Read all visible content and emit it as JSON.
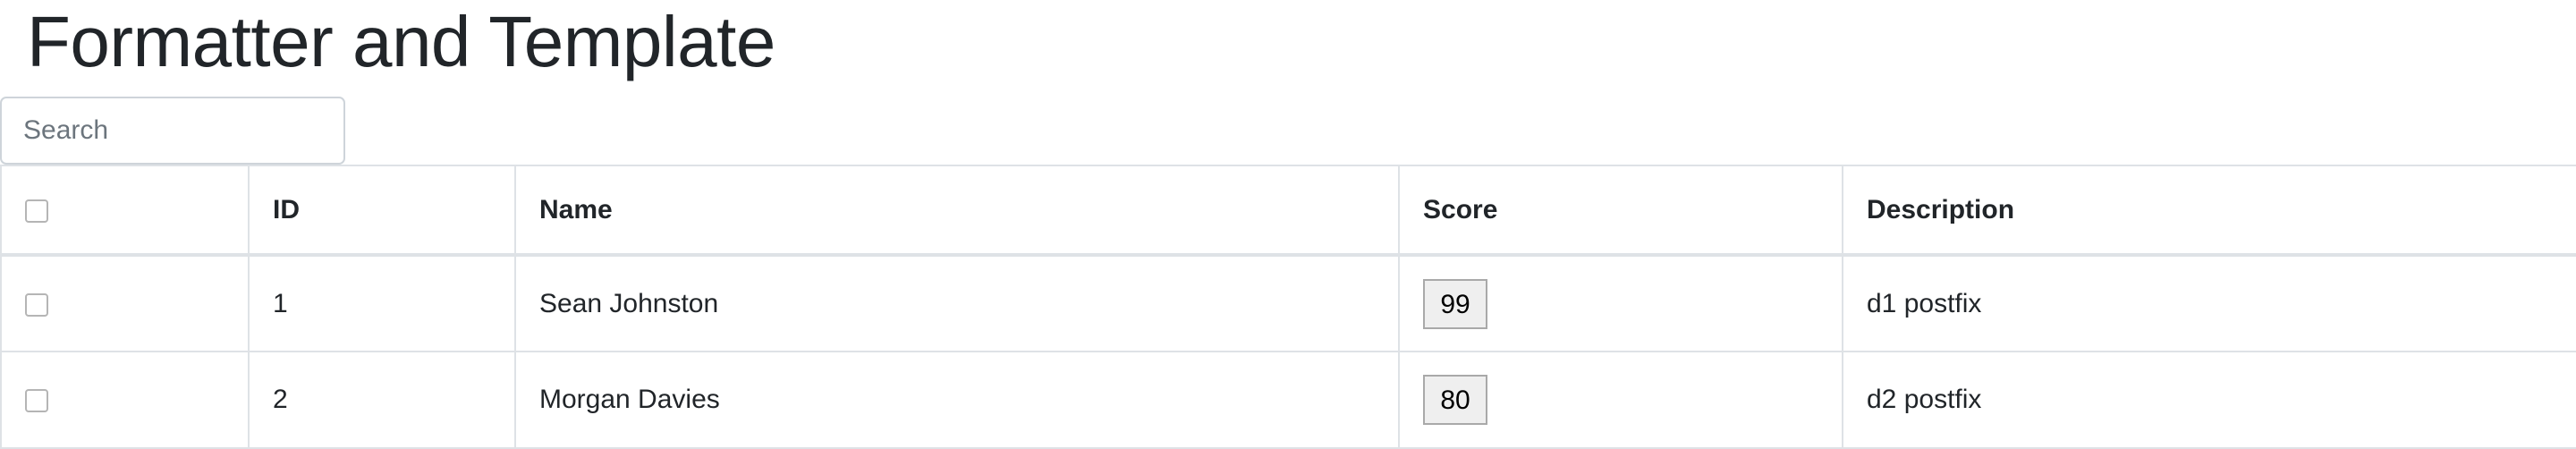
{
  "page": {
    "title": "Formatter and Template"
  },
  "search": {
    "placeholder": "Search",
    "value": ""
  },
  "table": {
    "columns": [
      {
        "label": ""
      },
      {
        "label": "ID"
      },
      {
        "label": "Name"
      },
      {
        "label": "Score"
      },
      {
        "label": "Description"
      }
    ],
    "rows": [
      {
        "checked": false,
        "id": "1",
        "name": "Sean Johnston",
        "score": "99",
        "description": "d1 postfix"
      },
      {
        "checked": false,
        "id": "2",
        "name": "Morgan Davies",
        "score": "80",
        "description": "d2 postfix"
      }
    ]
  },
  "colors": {
    "text": "#212529",
    "border": "#dee2e6",
    "input_border": "#ced4da",
    "score_box_bg": "#efefef"
  }
}
